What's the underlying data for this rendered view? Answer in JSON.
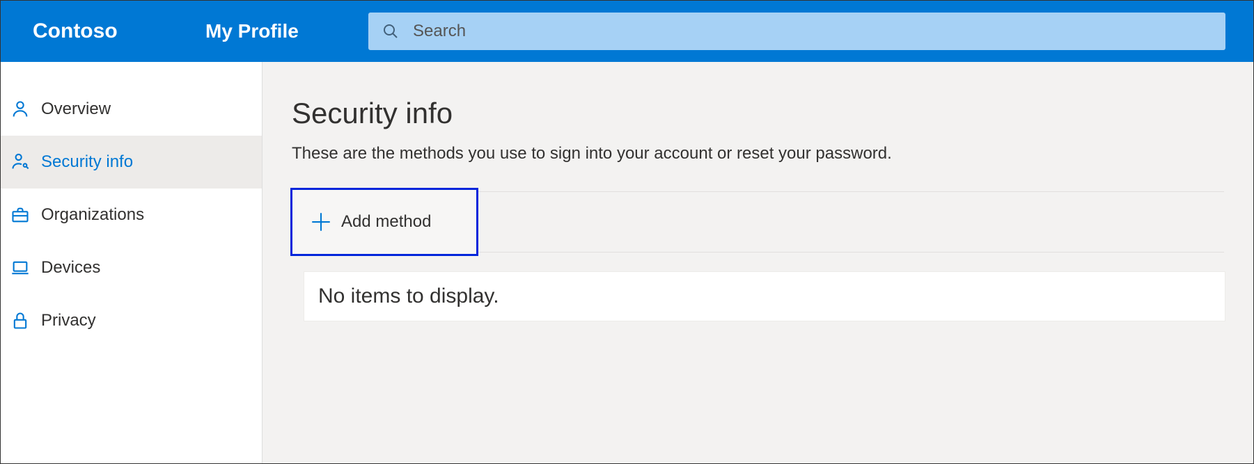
{
  "header": {
    "brand": "Contoso",
    "app_name": "My Profile",
    "search_placeholder": "Search"
  },
  "sidebar": {
    "items": [
      {
        "id": "overview",
        "label": "Overview",
        "icon": "person-icon",
        "active": false
      },
      {
        "id": "security-info",
        "label": "Security info",
        "icon": "person-key-icon",
        "active": true
      },
      {
        "id": "organizations",
        "label": "Organizations",
        "icon": "briefcase-icon",
        "active": false
      },
      {
        "id": "devices",
        "label": "Devices",
        "icon": "laptop-icon",
        "active": false
      },
      {
        "id": "privacy",
        "label": "Privacy",
        "icon": "lock-icon",
        "active": false
      }
    ]
  },
  "main": {
    "title": "Security info",
    "subtitle": "These are the methods you use to sign into your account or reset your password.",
    "add_method_label": "Add method",
    "no_items_text": "No items to display."
  }
}
